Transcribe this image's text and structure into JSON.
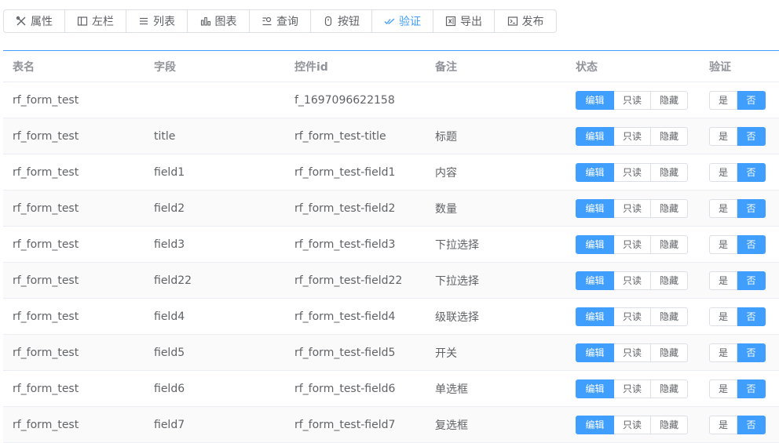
{
  "toolbar": [
    {
      "label": "属性",
      "icon": "tools-icon",
      "name": "toolbar-properties-button",
      "width": 78,
      "active": false
    },
    {
      "label": "左栏",
      "icon": "left-panel-icon",
      "name": "toolbar-left-panel-button",
      "width": 78,
      "active": false
    },
    {
      "label": "列表",
      "icon": "list-icon",
      "name": "toolbar-list-button",
      "width": 78,
      "active": false
    },
    {
      "label": "图表",
      "icon": "bar-chart-icon",
      "name": "toolbar-chart-button",
      "width": 79,
      "active": false
    },
    {
      "label": "查询",
      "icon": "search-list-icon",
      "name": "toolbar-query-button",
      "width": 78,
      "active": false
    },
    {
      "label": "按钮",
      "icon": "button-icon",
      "name": "toolbar-button-button",
      "width": 78,
      "active": false
    },
    {
      "label": "验证",
      "icon": "double-check-icon",
      "name": "toolbar-validate-button",
      "width": 78,
      "active": true
    },
    {
      "label": "导出",
      "icon": "excel-icon",
      "name": "toolbar-export-button",
      "width": 78,
      "active": false
    },
    {
      "label": "发布",
      "icon": "publish-icon",
      "name": "toolbar-publish-button",
      "width": 78,
      "active": false
    }
  ],
  "table": {
    "headers": [
      "表名",
      "字段",
      "控件id",
      "备注",
      "状态",
      "验证"
    ],
    "status_options": [
      "编辑",
      "只读",
      "隐藏"
    ],
    "verify_options": [
      "是",
      "否"
    ],
    "rows": [
      {
        "table": "rf_form_test",
        "field": "",
        "control_id": "f_1697096622158",
        "remark": "",
        "status": "编辑",
        "verify": "否"
      },
      {
        "table": "rf_form_test",
        "field": "title",
        "control_id": "rf_form_test-title",
        "remark": "标题",
        "status": "编辑",
        "verify": "否"
      },
      {
        "table": "rf_form_test",
        "field": "field1",
        "control_id": "rf_form_test-field1",
        "remark": "内容",
        "status": "编辑",
        "verify": "否"
      },
      {
        "table": "rf_form_test",
        "field": "field2",
        "control_id": "rf_form_test-field2",
        "remark": "数量",
        "status": "编辑",
        "verify": "否"
      },
      {
        "table": "rf_form_test",
        "field": "field3",
        "control_id": "rf_form_test-field3",
        "remark": "下拉选择",
        "status": "编辑",
        "verify": "否"
      },
      {
        "table": "rf_form_test",
        "field": "field22",
        "control_id": "rf_form_test-field22",
        "remark": "下拉选择",
        "status": "编辑",
        "verify": "否"
      },
      {
        "table": "rf_form_test",
        "field": "field4",
        "control_id": "rf_form_test-field4",
        "remark": "级联选择",
        "status": "编辑",
        "verify": "否"
      },
      {
        "table": "rf_form_test",
        "field": "field5",
        "control_id": "rf_form_test-field5",
        "remark": "开关",
        "status": "编辑",
        "verify": "否"
      },
      {
        "table": "rf_form_test",
        "field": "field6",
        "control_id": "rf_form_test-field6",
        "remark": "单选框",
        "status": "编辑",
        "verify": "否"
      },
      {
        "table": "rf_form_test",
        "field": "field7",
        "control_id": "rf_form_test-field7",
        "remark": "复选框",
        "status": "编辑",
        "verify": "否"
      }
    ]
  },
  "colors": {
    "accent": "#409eff",
    "text": "#606266",
    "header": "#909399",
    "border": "#dcdfe6"
  }
}
